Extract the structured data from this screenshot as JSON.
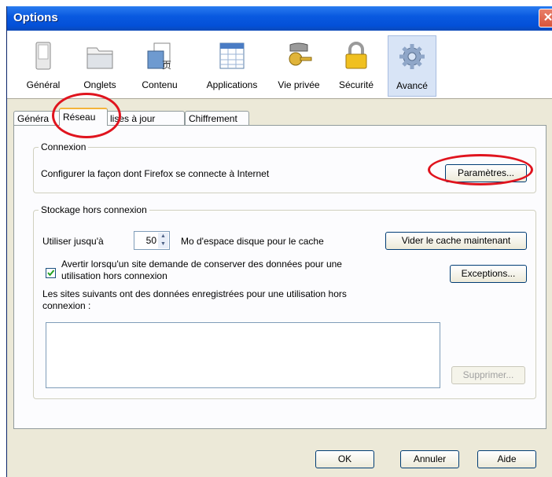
{
  "window": {
    "title": "Options",
    "close_glyph": "✕"
  },
  "toolbar": {
    "items": [
      {
        "label": "Général",
        "icon": "general-switch-icon"
      },
      {
        "label": "Onglets",
        "icon": "tabs-icon"
      },
      {
        "label": "Contenu",
        "icon": "content-icon"
      },
      {
        "label": "Applications",
        "icon": "applications-icon"
      },
      {
        "label": "Vie privée",
        "icon": "privacy-key-icon"
      },
      {
        "label": "Sécurité",
        "icon": "security-lock-icon"
      },
      {
        "label": "Avancé",
        "icon": "advanced-gear-icon"
      }
    ],
    "selected": "Avancé"
  },
  "tabs": {
    "items": [
      "Généra",
      "Réseau",
      "lises à jour",
      "Chiffrement"
    ],
    "selected": "Réseau"
  },
  "connexion": {
    "legend": "Connexion",
    "text": "Configurer la façon dont Firefox se connecte à Internet",
    "button": "Paramètres..."
  },
  "offline": {
    "legend": "Stockage hors connexion",
    "use_label": "Utiliser jusqu'à",
    "cache_value": "50",
    "cache_suffix": "Mo d'espace disque pour le cache",
    "clear_button": "Vider le cache maintenant",
    "warn_line1": "Avertir lorsqu'un site demande de conserver des données pour une",
    "warn_line2": "utilisation hors connexion",
    "warn_checked": true,
    "exceptions_button": "Exceptions...",
    "sites_line1": "Les sites suivants ont des données enregistrées pour une utilisation hors",
    "sites_line2": "connexion :",
    "remove_button": "Supprimer..."
  },
  "footer": {
    "ok": "OK",
    "cancel": "Annuler",
    "help": "Aide"
  },
  "colors": {
    "title_bar": "#0a5ae0",
    "annotation": "#e0141e",
    "dialog_bg": "#ece9d8",
    "selected_tool": "#d8e4f6"
  }
}
